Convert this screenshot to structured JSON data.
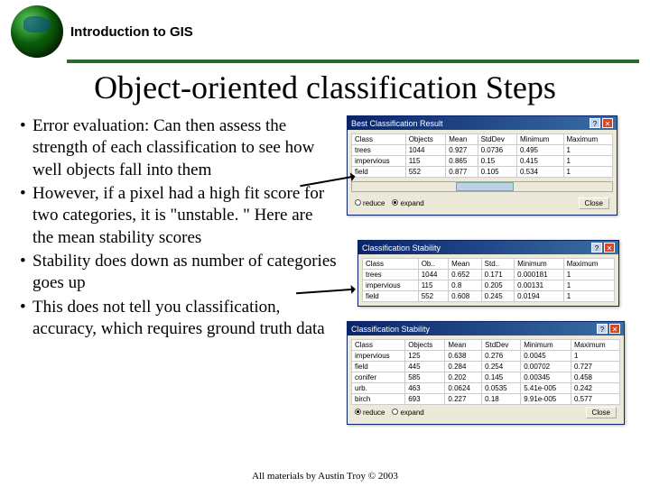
{
  "course": "Introduction to GIS",
  "title": "Object-oriented classification Steps",
  "bullets": [
    "Error evaluation: Can then assess the strength of each classification to see how well objects fall into them",
    "However, if a pixel had a high fit score for two categories, it is \"unstable. \" Here are the mean stability scores",
    "Stability does down as number of categories goes up",
    "This does not tell you classification, accuracy, which requires ground truth data"
  ],
  "win1": {
    "title": "Best Classification Result",
    "cols": [
      "Class",
      "Objects",
      "Mean",
      "StdDev",
      "Minimum",
      "Maximum"
    ],
    "rows": [
      [
        "trees",
        "1044",
        "0.927",
        "0.0736",
        "0.495",
        "1"
      ],
      [
        "impervious",
        "115",
        "0.865",
        "0.15",
        "0.415",
        "1"
      ],
      [
        "field",
        "552",
        "0.877",
        "0.105",
        "0.534",
        "1"
      ]
    ],
    "reduce": "reduce",
    "expand": "expand",
    "close": "Close"
  },
  "win2": {
    "title": "Classification Stability",
    "cols": [
      "Class",
      "Ob..",
      "Mean",
      "Std..",
      "Minimum",
      "Maximum"
    ],
    "rows": [
      [
        "trees",
        "1044",
        "0.652",
        "0.171",
        "0.000181",
        "1"
      ],
      [
        "impervious",
        "115",
        "0.8",
        "0.205",
        "0.00131",
        "1"
      ],
      [
        "field",
        "552",
        "0.608",
        "0.245",
        "0.0194",
        "1"
      ]
    ]
  },
  "win3": {
    "title": "Classification Stability",
    "cols": [
      "Class",
      "Objects",
      "Mean",
      "StdDev",
      "Minimum",
      "Maximum"
    ],
    "rows": [
      [
        "impervious",
        "125",
        "0.638",
        "0.276",
        "0.0045",
        "1"
      ],
      [
        "field",
        "445",
        "0.284",
        "0.254",
        "0.00702",
        "0.727"
      ],
      [
        "conifer",
        "585",
        "0.202",
        "0.145",
        "0.00345",
        "0.458"
      ],
      [
        "urb.",
        "463",
        "0.0624",
        "0.0535",
        "5.41e-005",
        "0.242"
      ],
      [
        "birch",
        "693",
        "0.227",
        "0.18",
        "9.91e-005",
        "0.577"
      ]
    ],
    "reduce": "reduce",
    "expand": "expand",
    "close": "Close"
  },
  "credit": "All materials by Austin Troy © 2003"
}
